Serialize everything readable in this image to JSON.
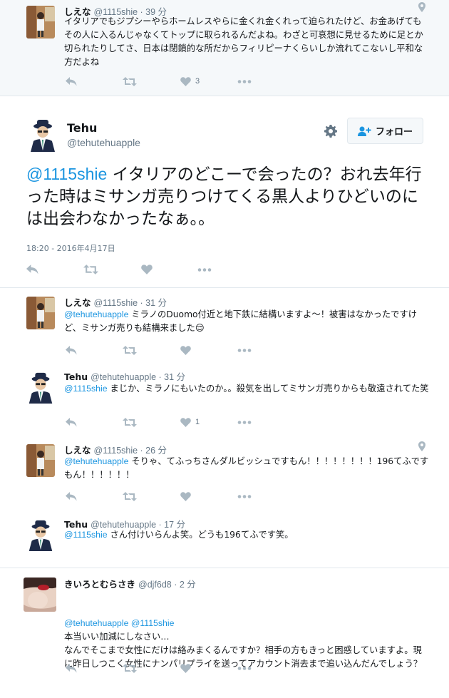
{
  "top_tweet": {
    "name": "しえな",
    "handle": "@1115shie · 39 分",
    "text": "イタリアでもジプシーやらホームレスやらに金くれ金くれって迫られたけど、お金あげてもその人に入るんじゃなくてトップに取られるんだよね。わざと可哀想に見せるために足とか切られたりしてさ、日本は閉鎖的な所だからフィリピーナくらいしか流れてこないし平和な方だよね",
    "like_count": "3",
    "icons": [
      "location-pin-icon",
      "reply-icon",
      "retweet-icon",
      "like-icon",
      "more-icon"
    ]
  },
  "main_tweet": {
    "name": "Tehu",
    "handle": "@tehutehuapple",
    "follow_label": "フォロー",
    "mention": "@1115shie",
    "text": " イタリアのどこーで会ったの？おれ去年行った時はミサンガ売りつけてくる黒人よりひどいのには出会わなかったなぁ。。",
    "timestamp": "18:20 - 2016年4月17日",
    "icons": [
      "gear-icon",
      "add-user-icon",
      "reply-icon",
      "retweet-icon",
      "like-icon",
      "more-icon"
    ]
  },
  "replies": [
    {
      "name": "しえな",
      "handle": "@1115shie · 31 分",
      "mention": "@tehutehuapple",
      "text": " ミラノのDuomo付近と地下鉄に結構いますよ〜！被害はなかったですけど、ミサンガ売りも結構来ました😌",
      "like_count": ""
    },
    {
      "name": "Tehu",
      "handle": "@tehutehuapple · 31 分",
      "mention": "@1115shie",
      "text": " まじか、ミラノにもいたのか。。殺気を出してミサンガ売りからも敬遠されてた笑",
      "like_count": "1"
    },
    {
      "name": "しえな",
      "handle": "@1115shie · 26 分",
      "mention": "@tehutehuapple",
      "text": " そりゃ、てふっちさんダルビッシュですもん！！！！！！！！196てふですもん！！！！！！",
      "like_count": ""
    },
    {
      "name": "Tehu",
      "handle": "@tehutehuapple · 17 分",
      "mention": "@1115shie",
      "text": " さん付けいらんよ笑。どうも196てふです笑。",
      "like_count": ""
    },
    {
      "name": "きいろとむらさき",
      "handle": "@djf6d8 · 2 分",
      "mention": "@tehutehuapple @1115shie",
      "text": "本当いい加減にしなさい…\nなんでそこまで女性にだけは絡みまくるんですか？相手の方もきっと困惑していますよ。現に昨日しつこく女性にナンパリプライを送ってアカウント消去まで追い込んだんでしょう？",
      "like_count": ""
    }
  ],
  "colors": {
    "mention": "#1b95e0",
    "thread_line": "#7fd7c4",
    "icon_gray": "#aab8c2",
    "text_gray": "#657786"
  }
}
